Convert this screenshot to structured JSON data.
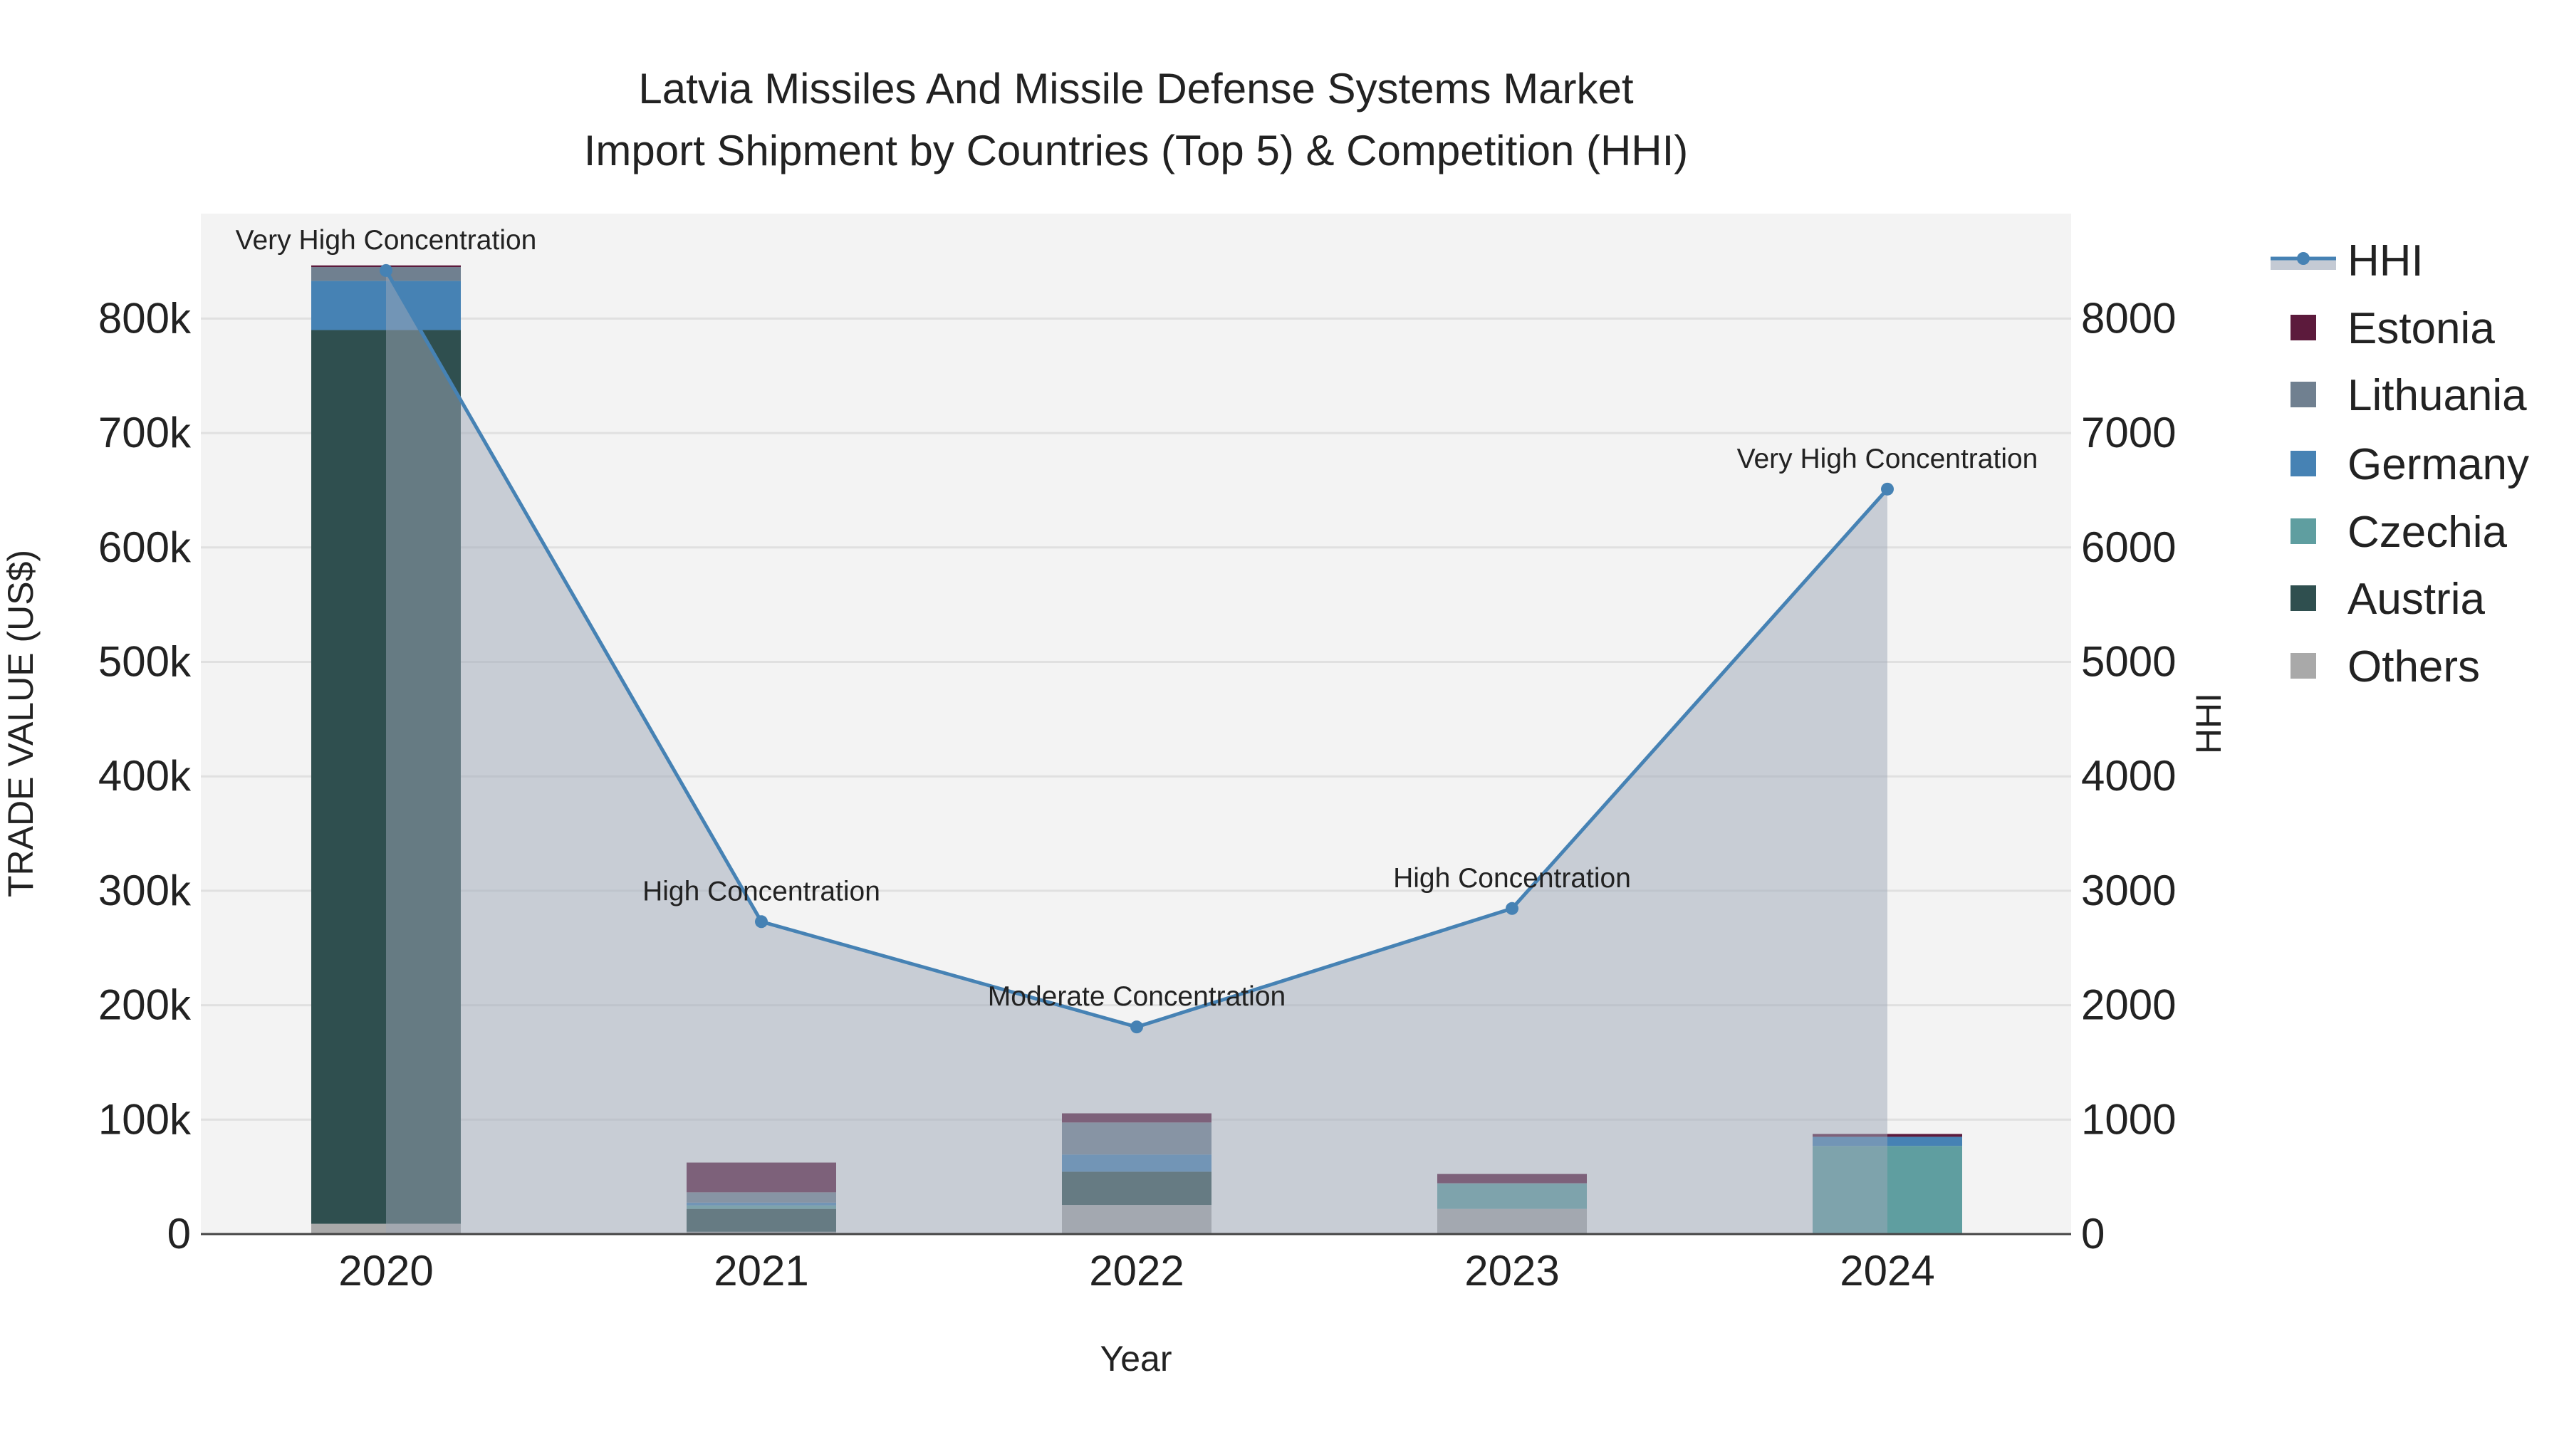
{
  "chart_data": {
    "type": "bar",
    "title_line1": "Latvia Missiles And Missile Defense Systems Market",
    "title_line2": "Import Shipment by Countries (Top 5) & Competition (HHI)",
    "xlabel": "Year",
    "ylabel": "TRADE VALUE (US$)",
    "y2label": "HHI",
    "categories": [
      "2020",
      "2021",
      "2022",
      "2023",
      "2024"
    ],
    "ylim": [
      0,
      890000
    ],
    "y2lim": [
      0,
      8900
    ],
    "yticks": [
      0,
      100000,
      200000,
      300000,
      400000,
      500000,
      600000,
      700000,
      800000
    ],
    "ytick_labels": [
      "0",
      "100k",
      "200k",
      "300k",
      "400k",
      "500k",
      "600k",
      "700k",
      "800k"
    ],
    "y2ticks": [
      0,
      1000,
      2000,
      3000,
      4000,
      5000,
      6000,
      7000,
      8000
    ],
    "y2tick_labels": [
      "0",
      "1000",
      "2000",
      "3000",
      "4000",
      "5000",
      "6000",
      "7000",
      "8000"
    ],
    "grid": true,
    "legend_placement": "right",
    "stack_series": [
      {
        "name": "Others",
        "color": "#a9a9a9",
        "values": [
          9000,
          2000,
          25500,
          22000,
          1000
        ]
      },
      {
        "name": "Austria",
        "color": "#2f4f4f",
        "values": [
          781000,
          20000,
          29000,
          0,
          0
        ]
      },
      {
        "name": "Czechia",
        "color": "#5f9ea0",
        "values": [
          0,
          3000,
          0,
          22000,
          76000
        ]
      },
      {
        "name": "Germany",
        "color": "#4682b4",
        "values": [
          43000,
          2500,
          15000,
          0,
          8000
        ]
      },
      {
        "name": "Lithuania",
        "color": "#708090",
        "values": [
          12000,
          9000,
          28000,
          500,
          0
        ]
      },
      {
        "name": "Estonia",
        "color": "#5c1a3c",
        "values": [
          1500,
          26000,
          8000,
          8000,
          2500
        ]
      }
    ],
    "hhi": {
      "name": "HHI",
      "color": "#4682b4",
      "values": [
        8420,
        2730,
        1810,
        2845,
        6510
      ],
      "annotations": [
        "Very High Concentration",
        "High Concentration",
        "Moderate Concentration",
        "High Concentration",
        "Very High Concentration"
      ]
    },
    "legend": [
      "HHI",
      "Estonia",
      "Lithuania",
      "Germany",
      "Czechia",
      "Austria",
      "Others"
    ]
  }
}
